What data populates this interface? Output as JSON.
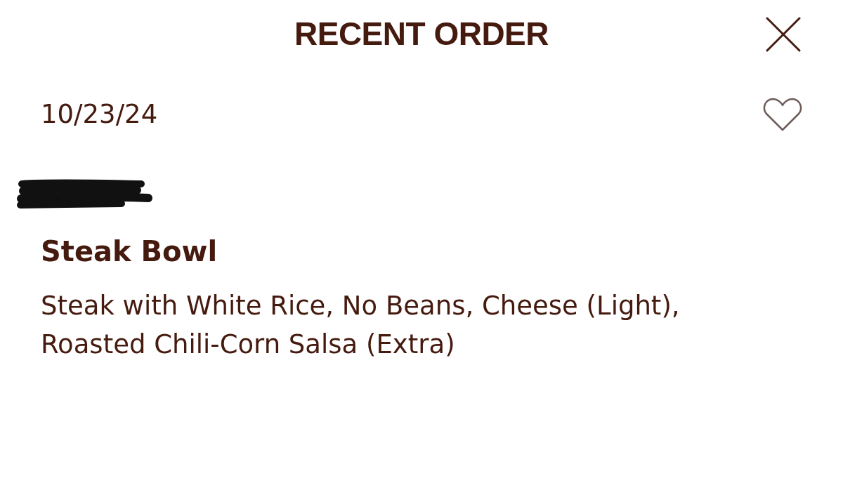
{
  "header": {
    "title": "RECENT ORDER"
  },
  "order": {
    "date": "10/23/24",
    "favorited": false,
    "item_name": "Steak Bowl",
    "description": "Steak with White Rice, No Beans, Cheese (Light), Roasted Chili-Corn Salsa (Extra)"
  }
}
